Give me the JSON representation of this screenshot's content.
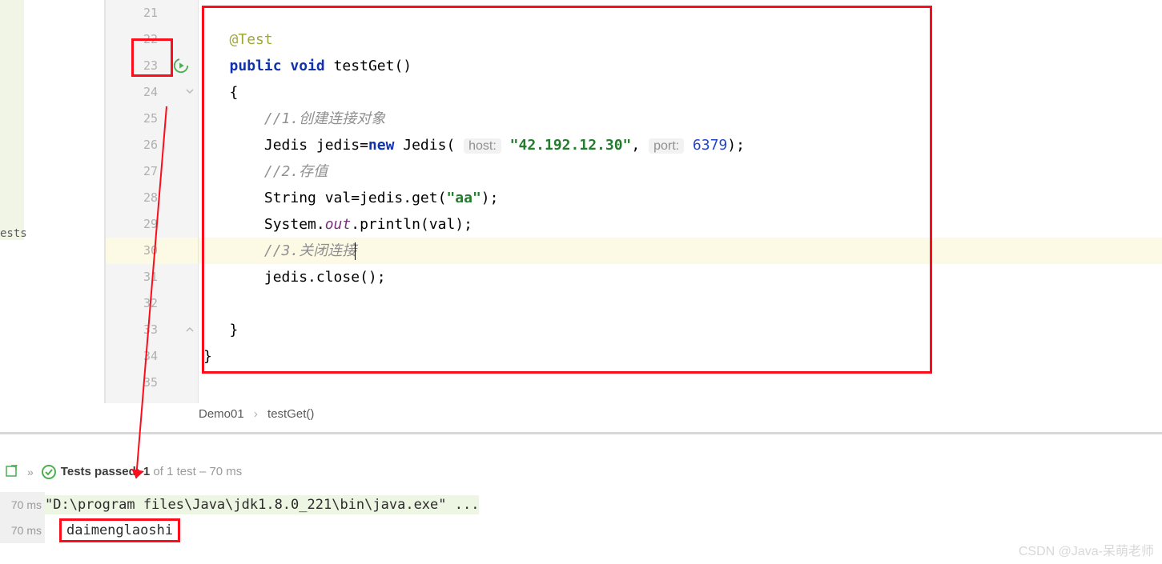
{
  "gutter": {
    "start": 21,
    "end": 35
  },
  "code": {
    "annotation": "@Test",
    "kw_public": "public",
    "kw_void": "void",
    "method": "testGet",
    "brace_open": "{",
    "comment1": "//1.创建连接对象",
    "l_jedis_decl": "Jedis jedis=",
    "kw_new": "new",
    "l_jedis_ctor": " Jedis(",
    "hint_host": "host:",
    "str_host": "\"42.192.12.30\"",
    "comma": ",",
    "hint_port": "port:",
    "num_port": "6379",
    "l_close_paren": ");",
    "comment2": "//2.存值",
    "l_get_pre": "String val=jedis.get(",
    "str_aa": "\"aa\"",
    "l_get_post": ");",
    "l_println_pre": "System.",
    "field_out": "out",
    "l_println_post": ".println(val);",
    "comment3": "//3.关闭连接",
    "l_close": "jedis.close();",
    "brace_close1": "}",
    "brace_close2": "}"
  },
  "breadcrumb": {
    "cls": "Demo01",
    "method": "testGet()"
  },
  "run": {
    "passed_label": "Tests passed: 1",
    "passed_suffix": " of 1 test – 70 ms",
    "time1": "70 ms",
    "time2": "70 ms",
    "cmd": "\"D:\\program files\\Java\\jdk1.8.0_221\\bin\\java.exe\" ...",
    "output": "daimenglaoshi"
  },
  "left": {
    "tests_label": "ests"
  },
  "watermark": "CSDN @Java-呆萌老师"
}
